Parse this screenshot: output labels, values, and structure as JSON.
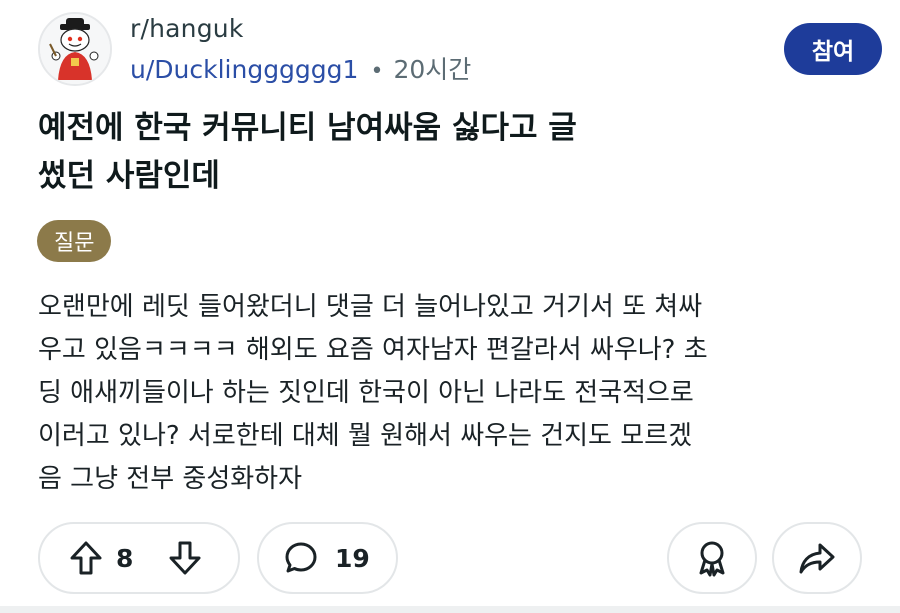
{
  "post": {
    "subreddit": "r/hanguk",
    "author": "u/Ducklingggggg1",
    "separator": "•",
    "time": "20시간",
    "join_label": "참여",
    "title_line1": "예전에 한국 커뮤니티 남여싸움 싫다고 글",
    "title_line2": "썼던 사람인데",
    "flair": "질문",
    "body_lines": [
      "오랜만에 레딧 들어왔더니 댓글 더 늘어나있고 거기서 또 쳐싸",
      "우고 있음ㅋㅋㅋㅋ 해외도 요즘 여자남자 편갈라서 싸우나? 초",
      "딩 애새끼들이나 하는 짓인데 한국이 아닌 나라도 전국적으로",
      "이러고 있나? 서로한테 대체 뭘 원해서 싸우는 건지도 모르겠",
      "음 그냥 전부 중성화하자"
    ]
  },
  "actions": {
    "vote_count": "8",
    "comment_count": "19"
  },
  "icons": {
    "avatar": "subreddit-avatar-mascot",
    "upvote": "upvote-arrow-icon",
    "downvote": "downvote-arrow-icon",
    "comment": "comment-bubble-icon",
    "award": "award-icon",
    "share": "share-arrow-icon"
  },
  "colors": {
    "join_button": "#1e3c9a",
    "author_link": "#2b4ea6",
    "flair_background": "#8c7a4a"
  }
}
